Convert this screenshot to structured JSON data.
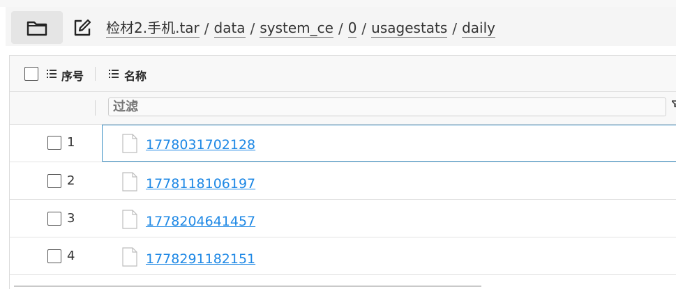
{
  "breadcrumb": {
    "items": [
      "检材2.手机.tar",
      "data",
      "system_ce",
      "0",
      "usagestats",
      "daily"
    ],
    "separator": "/"
  },
  "toolbar": {
    "folder_icon": "folder-icon",
    "edit_icon": "edit-icon"
  },
  "table": {
    "columns": {
      "index": "序号",
      "name": "名称"
    },
    "filter": {
      "placeholder": "过滤",
      "value": ""
    },
    "rows": [
      {
        "index": "1",
        "name": "1778031702128"
      },
      {
        "index": "2",
        "name": "1778118106197"
      },
      {
        "index": "3",
        "name": "1778204641457"
      },
      {
        "index": "4",
        "name": "1778291182151"
      }
    ],
    "active_row": "1"
  },
  "colors": {
    "link": "#1e88e5",
    "active_border": "#3a8fc4"
  }
}
